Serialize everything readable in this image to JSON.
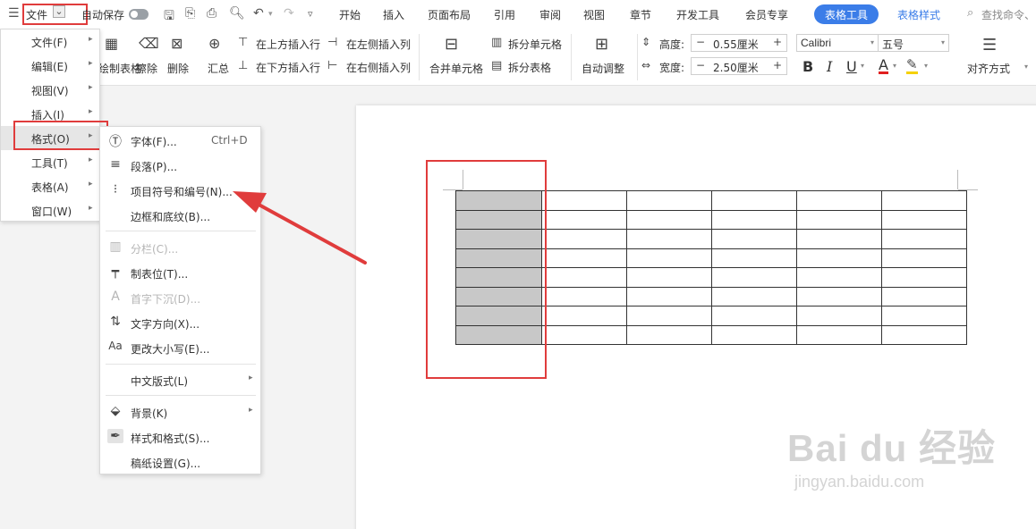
{
  "topbar": {
    "menu_label": "文件",
    "autosave_label": "自动保存",
    "tabs": [
      "开始",
      "插入",
      "页面布局",
      "引用",
      "审阅",
      "视图",
      "章节",
      "开发工具",
      "会员专享"
    ],
    "active_tab": "表格工具",
    "blue_tab": "表格样式",
    "search_placeholder": "查找命令、"
  },
  "ribbon": {
    "draw_table": "绘制表格",
    "eraser": "擦除",
    "delete": "删除",
    "summary": "汇总",
    "insert_above": "在上方插入行",
    "insert_below": "在下方插入行",
    "insert_left": "在左侧插入列",
    "insert_right": "在右侧插入列",
    "merge_cells": "合并单元格",
    "split_cells": "拆分单元格",
    "split_table": "拆分表格",
    "auto_fit": "自动调整",
    "height_label": "高度:",
    "height_value": "0.55厘米",
    "width_label": "宽度:",
    "width_value": "2.50厘米",
    "font_name": "Calibri",
    "font_size": "五号",
    "bold": "B",
    "italic": "I",
    "underline": "U",
    "font_color": "A",
    "align": "对齐方式"
  },
  "file_menu": {
    "items": [
      {
        "label": "文件(F)"
      },
      {
        "label": "编辑(E)"
      },
      {
        "label": "视图(V)"
      },
      {
        "label": "插入(I)"
      },
      {
        "label": "格式(O)"
      },
      {
        "label": "工具(T)"
      },
      {
        "label": "表格(A)"
      },
      {
        "label": "窗口(W)"
      }
    ]
  },
  "format_menu": {
    "items": [
      {
        "label": "字体(F)...",
        "shortcut": "Ctrl+D"
      },
      {
        "label": "段落(P)..."
      },
      {
        "label": "项目符号和编号(N)..."
      },
      {
        "label": "边框和底纹(B)..."
      },
      {
        "label": "分栏(C)..."
      },
      {
        "label": "制表位(T)..."
      },
      {
        "label": "首字下沉(D)..."
      },
      {
        "label": "文字方向(X)..."
      },
      {
        "label": "更改大小写(E)..."
      },
      {
        "label": "中文版式(L)"
      },
      {
        "label": "背景(K)"
      },
      {
        "label": "样式和格式(S)..."
      },
      {
        "label": "稿纸设置(G)..."
      }
    ]
  },
  "colors": {
    "accent": "#3b7de8",
    "highlight_box": "#e03c3c",
    "selected_cells": "#c8c8c8"
  },
  "watermark": {
    "brand": "Bai du 经验",
    "url": "jingyan.baidu.com"
  }
}
